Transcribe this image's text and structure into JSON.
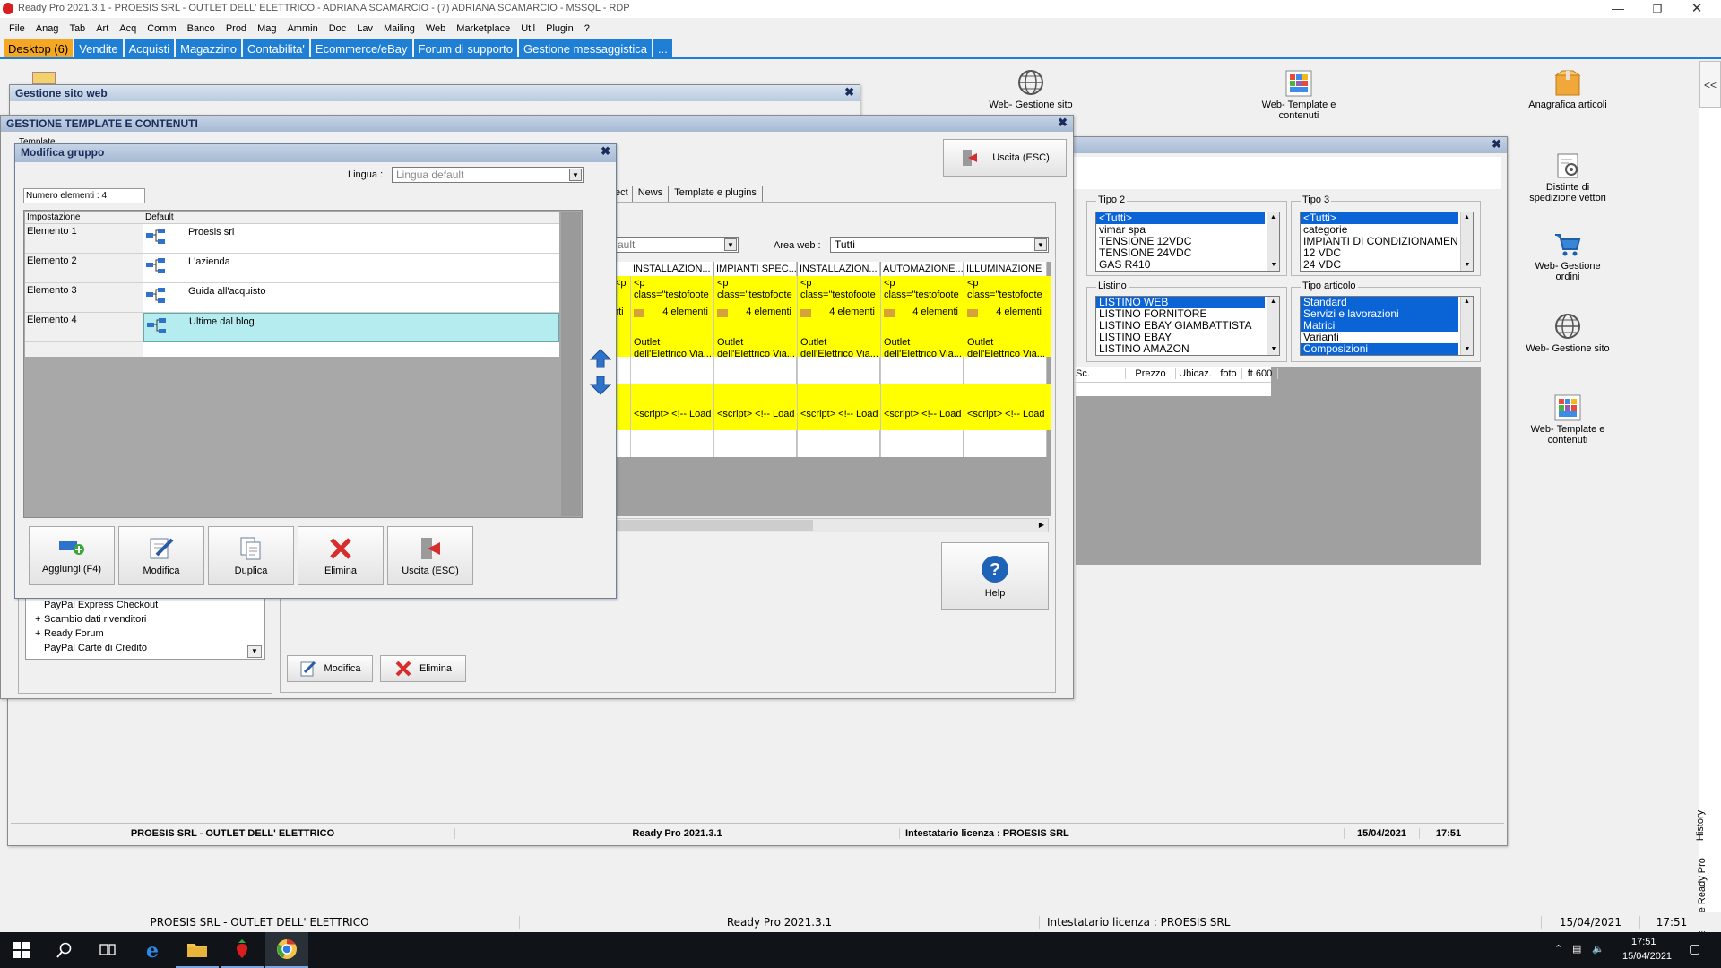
{
  "app": {
    "title": "Ready Pro 2021.3.1 - PROESIS SRL - OUTLET DELL' ELETTRICO - ADRIANA SCAMARCIO - (7) ADRIANA SCAMARCIO - MSSQL - RDP",
    "menu": [
      "File",
      "Anag",
      "Tab",
      "Art",
      "Acq",
      "Comm",
      "Banco",
      "Prod",
      "Mag",
      "Ammin",
      "Doc",
      "Lav",
      "Mailing",
      "Web",
      "Marketplace",
      "Util",
      "Plugin",
      "?"
    ],
    "tabs": [
      "Desktop (6)",
      "Vendite",
      "Acquisti",
      "Magazzino",
      "Contabilita'",
      "Ecommerce/eBay",
      "Forum di supporto",
      "Gestione messaggistica",
      "..."
    ]
  },
  "desktop_icons": [
    {
      "label": "Web- Gestione sito",
      "icon": "globe-icon"
    },
    {
      "label": "Web- Template e contenuti",
      "icon": "template-icon"
    },
    {
      "label": "Anagrafica articoli",
      "icon": "box-icon"
    },
    {
      "label": "Distinte di spedizione vettori",
      "icon": "gear-doc-icon"
    },
    {
      "label": "Web- Gestione ordini",
      "icon": "cart-icon"
    },
    {
      "label": "Web- Gestione sito",
      "icon": "globe-icon"
    },
    {
      "label": "Web- Template e contenuti",
      "icon": "template-icon"
    }
  ],
  "win_sito": {
    "title": "Gestione sito web"
  },
  "win_template": {
    "title": "GESTIONE TEMPLATE E CONTENUTI",
    "uscita": "Uscita (ESC)",
    "help": "Help",
    "tabs": [
      "ect",
      "News",
      "Template e plugins"
    ],
    "combo_lingua_partial": "ault",
    "area_web_label": "Area web :",
    "area_web_value": "Tutti",
    "col_headers": [
      "INSTALLAZION...",
      "IMPIANTI SPEC...",
      "INSTALLAZION...",
      "AUTOMAZIONE...",
      "ILLUMINAZIONE"
    ],
    "row1": "<p class=\"testofoote",
    "row2": "4 elementi",
    "row3": "Outlet dell'Elettrico Via...",
    "row4": "<script> <!-- Load",
    "partial_row1": "<p",
    "partial_row2": "nti",
    "modifica": "Modifica",
    "elimina": "Elimina",
    "tree": [
      {
        "label": "PayPal Express Checkout",
        "expand": ""
      },
      {
        "label": "Scambio dati rivenditori",
        "expand": "+"
      },
      {
        "label": "Ready Forum",
        "expand": "+"
      },
      {
        "label": "PayPal Carte di Credito",
        "expand": ""
      }
    ],
    "template_label": "Template"
  },
  "filters": {
    "tipo2": {
      "label": "Tipo 2",
      "items": [
        "<Tutti>",
        "vimar spa",
        "TENSIONE 12VDC",
        "TENSIONE 24VDC",
        "GAS R410"
      ],
      "selected": [
        0
      ]
    },
    "tipo3": {
      "label": "Tipo 3",
      "items": [
        "<Tutti>",
        "categorie",
        "IMPIANTI DI CONDIZIONAMEN",
        "12 VDC",
        "24 VDC"
      ],
      "selected": [
        0
      ]
    },
    "listino": {
      "label": "Listino",
      "items": [
        "LISTINO WEB",
        "LISTINO FORNITORE",
        "LISTINO EBAY GIAMBATTISTA",
        "LISTINO EBAY",
        "LISTINO AMAZON"
      ],
      "selected": [
        0
      ]
    },
    "tipo_articolo": {
      "label": "Tipo articolo",
      "items": [
        "Standard",
        "Servizi e lavorazioni",
        "Matrici",
        "Varianti",
        "Composizioni"
      ],
      "selected": [
        0,
        1,
        2,
        4
      ]
    },
    "grid_headers": [
      "Sc.",
      "Prezzo",
      "Ubicaz.",
      "foto",
      "ft 600"
    ]
  },
  "dialog": {
    "title": "Modifica gruppo",
    "lingua_label": "Lingua :",
    "lingua_value": "Lingua default",
    "numero": "Numero elementi : 4",
    "col_impostazione": "Impostazione",
    "col_default": "Default",
    "rows": [
      {
        "name": "Elemento 1",
        "value": "Proesis srl"
      },
      {
        "name": "Elemento 2",
        "value": "L'azienda"
      },
      {
        "name": "Elemento 3",
        "value": "Guida all'acquisto"
      },
      {
        "name": "Elemento 4",
        "value": "Ultime dal blog"
      }
    ],
    "buttons": [
      "Aggiungi (F4)",
      "Modifica",
      "Duplica",
      "Elimina",
      "Uscita (ESC)"
    ]
  },
  "inner_status": {
    "company": "PROESIS SRL - OUTLET DELL' ELETTRICO",
    "version": "Ready Pro 2021.3.1",
    "license": "Intestatario licenza : PROESIS SRL",
    "date": "15/04/2021",
    "time": "17:51"
  },
  "outer_status": {
    "company": "PROESIS SRL - OUTLET DELL' ELETTRICO",
    "version": "Ready Pro 2021.3.1",
    "license": "Intestatario licenza : PROESIS SRL",
    "date": "15/04/2021",
    "time": "17:51"
  },
  "side_tabs": [
    "History",
    "Assistente Ready Pro"
  ],
  "side_collapse": "<<",
  "taskbar": {
    "time": "17:51",
    "date": "15/04/2021"
  },
  "colors": {
    "accent": "#0a64d6",
    "highlight_yellow": "#ffff00",
    "selected_row": "#b4ecf0",
    "tab_active": "#f5a623",
    "tab_bg": "#1e7fd4"
  }
}
